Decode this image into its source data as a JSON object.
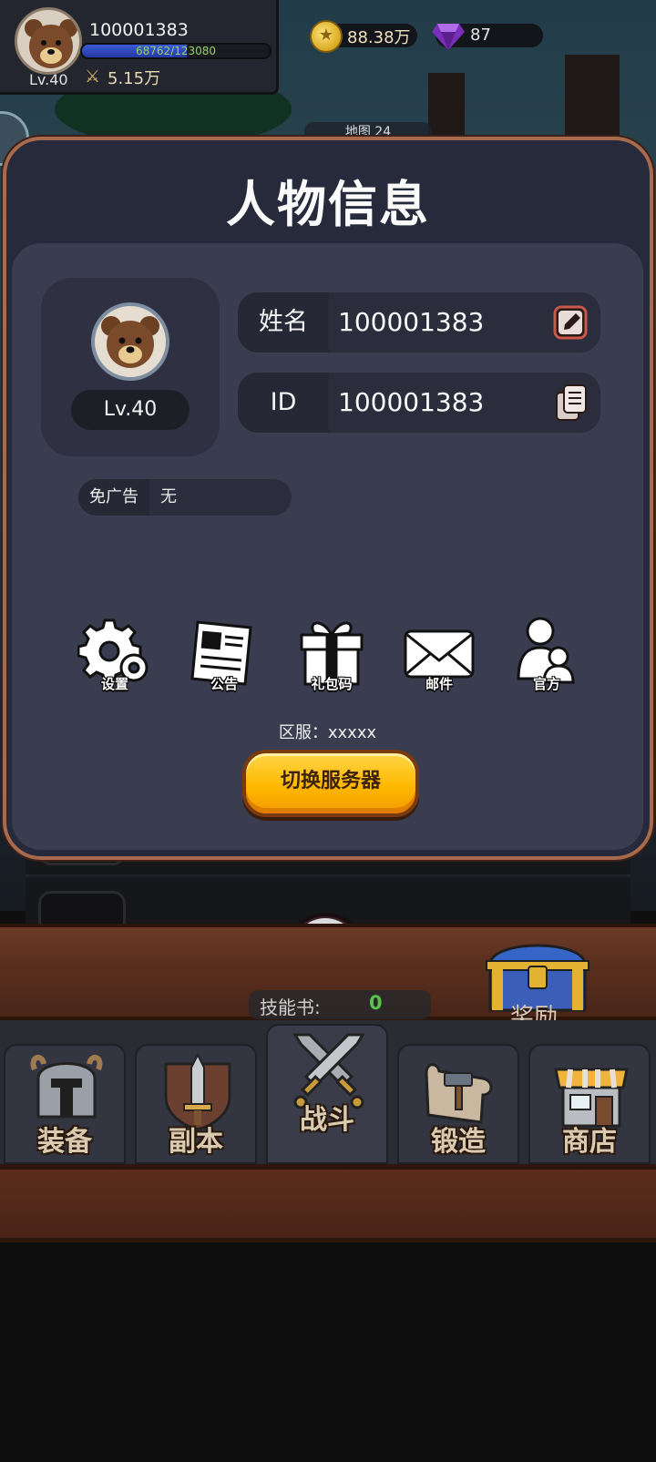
{
  "player": {
    "name": "100001383",
    "exp_text": "68762/123080",
    "exp_fraction": 0.5587,
    "level": "Lv.40",
    "power": "5.15万"
  },
  "currency": {
    "gold": "88.38万",
    "gems": "87"
  },
  "background": {
    "map_tag": "地图 24"
  },
  "dialog": {
    "title": "人物信息",
    "level": "Lv.40",
    "name_label": "姓名",
    "name_value": "100001383",
    "id_label": "ID",
    "id_value": "100001383",
    "ad_label": "免广告",
    "ad_value": "无",
    "functions": [
      "设置",
      "公告",
      "礼包码",
      "邮件",
      "官方"
    ],
    "server_text": "区服：xxxxx",
    "switch_button": "切换服务器"
  },
  "bottom": {
    "skill_book_label": "技能书:",
    "skill_book_value": "0",
    "reward_label": "奖励",
    "tabs": [
      "装备",
      "副本",
      "战斗",
      "锻造",
      "商店"
    ]
  },
  "colors": {
    "dialog_border": "#a86a4c",
    "dialog_bg": "#272a3a",
    "inner_bg": "#3a3d4f",
    "button_yellow": "#ffb800",
    "wood": "#5a2f1e",
    "exp_fill": "#3d5bd3",
    "skill_value": "#58c24a"
  },
  "icons": {
    "settings": "gear-icon",
    "notice": "newspaper-icon",
    "gift": "gift-icon",
    "mail": "mail-icon",
    "official": "person-icon",
    "edit": "edit-icon",
    "copy": "copy-icon",
    "close": "close-icon"
  }
}
